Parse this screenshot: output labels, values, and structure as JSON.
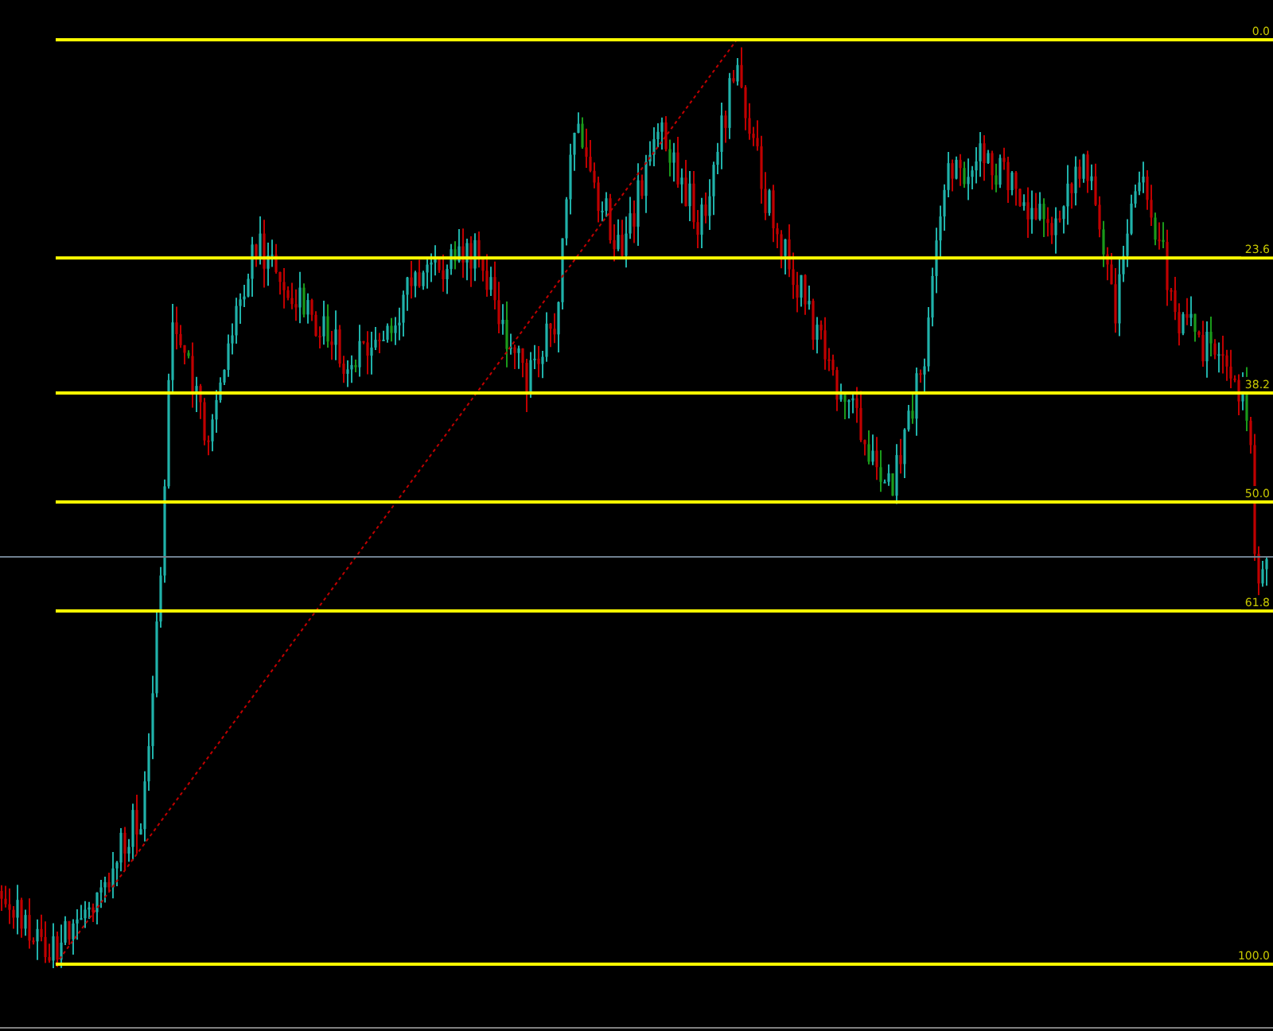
{
  "fib_levels": [
    {
      "label": "0.0"
    },
    {
      "label": "23.6"
    },
    {
      "label": "38.2"
    },
    {
      "label": "50.0"
    },
    {
      "label": "61.8"
    },
    {
      "label": "100.0"
    }
  ]
}
